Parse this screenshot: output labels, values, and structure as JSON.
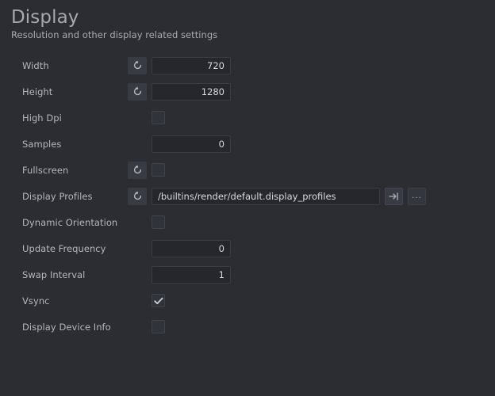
{
  "header": {
    "title": "Display",
    "subtitle": "Resolution and other display related settings"
  },
  "icons": {
    "revert": "revert-icon",
    "goto": "go-to-resource-icon",
    "browse": "browse-ellipsis-icon",
    "check": "check-icon"
  },
  "settings": {
    "rows": [
      {
        "label": "Width",
        "type": "number",
        "value": "720",
        "revert": true,
        "name": "width"
      },
      {
        "label": "Height",
        "type": "number",
        "value": "1280",
        "revert": true,
        "name": "height"
      },
      {
        "label": "High Dpi",
        "type": "checkbox",
        "checked": false,
        "revert": false,
        "name": "high-dpi"
      },
      {
        "label": "Samples",
        "type": "number",
        "value": "0",
        "revert": false,
        "name": "samples"
      },
      {
        "label": "Fullscreen",
        "type": "checkbox",
        "checked": false,
        "revert": true,
        "name": "fullscreen"
      },
      {
        "label": "Display Profiles",
        "type": "path",
        "value": "/builtins/render/default.display_profiles",
        "revert": true,
        "name": "display-profiles",
        "browse_label": "..."
      },
      {
        "label": "Dynamic Orientation",
        "type": "checkbox",
        "checked": false,
        "revert": false,
        "name": "dynamic-orientation"
      },
      {
        "label": "Update Frequency",
        "type": "number",
        "value": "0",
        "revert": false,
        "name": "update-frequency"
      },
      {
        "label": "Swap Interval",
        "type": "number",
        "value": "1",
        "revert": false,
        "name": "swap-interval"
      },
      {
        "label": "Vsync",
        "type": "checkbox",
        "checked": true,
        "revert": false,
        "name": "vsync"
      },
      {
        "label": "Display Device Info",
        "type": "checkbox",
        "checked": false,
        "revert": false,
        "name": "display-device-info"
      }
    ]
  },
  "colors": {
    "background": "#2b2d33",
    "field_background": "#25272c",
    "button_background": "#383b42",
    "label_text": "#b4b7bd",
    "value_text": "#d7d9dd",
    "title_text": "#a6a9af"
  }
}
